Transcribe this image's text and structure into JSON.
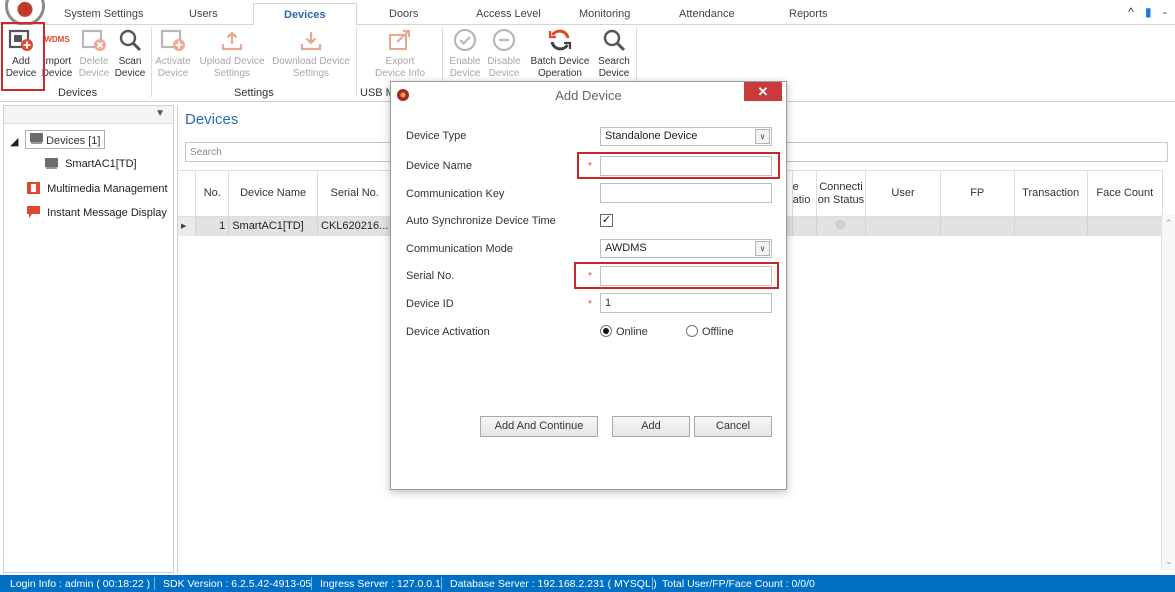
{
  "tabs": [
    "System Settings",
    "Users",
    "Devices",
    "Doors",
    "Access Level",
    "Monitoring",
    "Attendance",
    "Reports"
  ],
  "active_tab": "Devices",
  "window_controls": {
    "minimize_ribbon": "^",
    "more": "-"
  },
  "ribbon": {
    "devices_group": {
      "label": "Devices",
      "add_device": [
        "Add",
        "Device"
      ],
      "import_device": [
        "Import",
        "Device"
      ],
      "import_badge": "WDMS",
      "delete_device": [
        "Delete",
        "Device"
      ],
      "scan_device": [
        "Scan",
        "Device"
      ]
    },
    "settings_group": {
      "label": "Settings",
      "activate_device": [
        "Activate",
        "Device"
      ],
      "upload_settings": [
        "Upload Device",
        "Settings"
      ],
      "download_settings": [
        "Download Device",
        "Settings"
      ]
    },
    "usb_group": {
      "label": "USB M",
      "export_device_info": [
        "Export",
        "Device Info"
      ]
    },
    "other_group": {
      "enable_device": [
        "Enable",
        "Device"
      ],
      "disable_device": [
        "Disable",
        "Device"
      ],
      "batch_operation": [
        "Batch Device",
        "Operation"
      ],
      "search_device": [
        "Search",
        "Device"
      ]
    }
  },
  "tree": {
    "root": "Devices [1]",
    "child": "SmartAC1[TD]",
    "multimedia": "Multimedia Management",
    "instant_message": "Instant Message Display"
  },
  "main": {
    "title": "Devices",
    "search_placeholder": "Search",
    "columns": [
      "No.",
      "Device Name",
      "Serial No.",
      "e atio",
      "Connecti on Status",
      "User",
      "FP",
      "Transaction",
      "Face Count"
    ],
    "rows": [
      {
        "no": "1",
        "name": "SmartAC1[TD]",
        "serial": "CKL620216..."
      }
    ]
  },
  "dialog": {
    "title": "Add Device",
    "close": "✕",
    "fields": {
      "device_type": {
        "label": "Device Type",
        "value": "Standalone Device"
      },
      "device_name": {
        "label": "Device Name",
        "value": ""
      },
      "communication_key": {
        "label": "Communication Key",
        "value": ""
      },
      "auto_sync": {
        "label": "Auto Synchronize Device Time",
        "checked": true
      },
      "communication_mode": {
        "label": "Communication Mode",
        "value": "AWDMS"
      },
      "serial_no": {
        "label": "Serial No.",
        "value": ""
      },
      "device_id": {
        "label": "Device ID",
        "value": "1"
      },
      "activation": {
        "label": "Device Activation",
        "options": [
          "Online",
          "Offline"
        ],
        "selected": "Online"
      }
    },
    "buttons": {
      "add_continue": "Add And Continue",
      "add": "Add",
      "cancel": "Cancel"
    }
  },
  "status_bar": {
    "login": "Login Info : admin ( 00:18:22 )",
    "sdk": "SDK Version : 6.2.5.42-4913-05",
    "ingress": "Ingress Server : 127.0.0.1",
    "database": "Database Server : 192.168.2.231 ( MYSQL )",
    "totals": "Total User/FP/Face Count : 0/0/0"
  },
  "colors": {
    "accent": "#2a6ab4",
    "statusbar": "#0070c4",
    "highlight": "#c62828",
    "close": "#c93a3a"
  }
}
